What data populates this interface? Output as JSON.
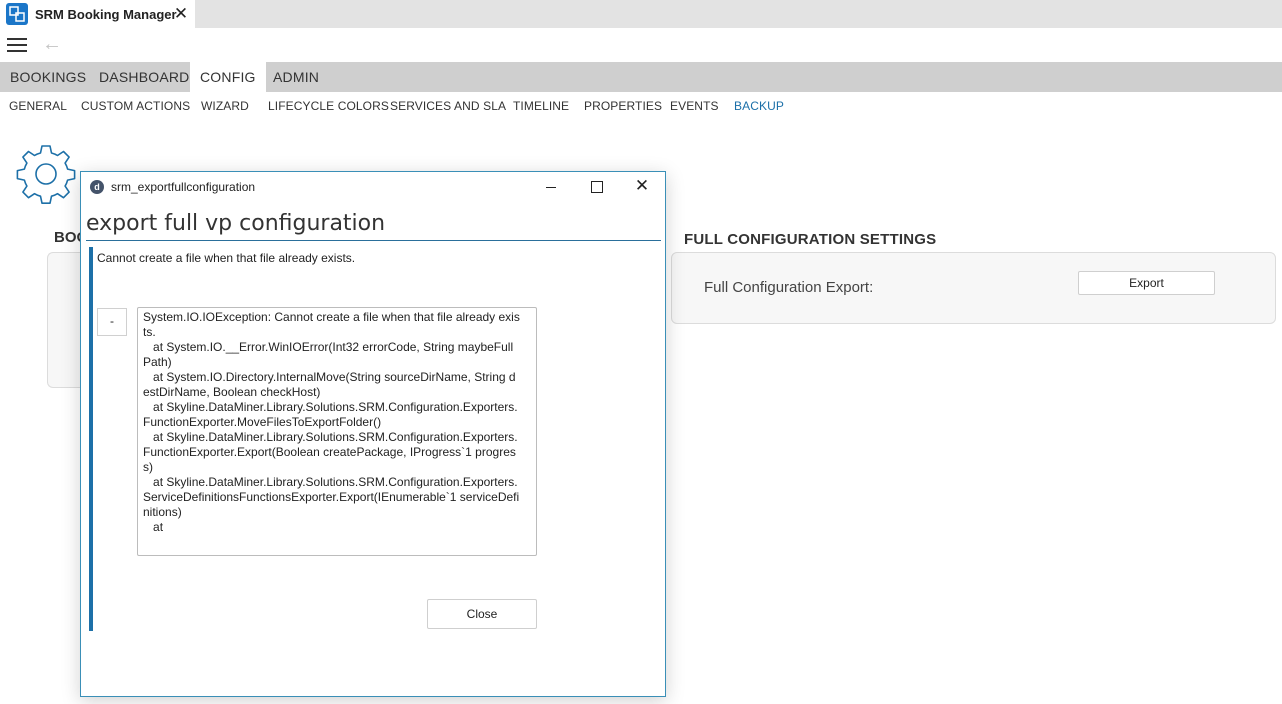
{
  "window": {
    "tab_title": "SRM Booking Manager",
    "tab_close": "✕"
  },
  "toolbar": {
    "back_glyph": "←"
  },
  "main_nav": [
    {
      "label": "BOOKINGS",
      "active": false
    },
    {
      "label": "DASHBOARD",
      "active": false
    },
    {
      "label": "CONFIG",
      "active": true
    },
    {
      "label": "ADMIN",
      "active": false
    }
  ],
  "sub_nav": [
    {
      "label": "GENERAL",
      "active": false
    },
    {
      "label": "CUSTOM ACTIONS",
      "active": false
    },
    {
      "label": "WIZARD",
      "active": false
    },
    {
      "label": "LIFECYCLE COLORS",
      "active": false
    },
    {
      "label": "SERVICES AND SLA",
      "active": false
    },
    {
      "label": "TIMELINE",
      "active": false
    },
    {
      "label": "PROPERTIES",
      "active": false
    },
    {
      "label": "EVENTS",
      "active": false
    },
    {
      "label": "BACKUP",
      "active": true
    }
  ],
  "page": {
    "left_heading_partial": "BOO",
    "full_config": {
      "heading": "FULL CONFIGURATION SETTINGS",
      "label": "Full Configuration Export:",
      "button": "Export"
    }
  },
  "dialog": {
    "icon_letter": "d",
    "window_title": "srm_exportfullconfiguration",
    "close_glyph": "✕",
    "heading": "export full vp configuration",
    "message": "Cannot create a file when that file already exists.",
    "collapse_label": "-",
    "details_lines": [
      "System.IO.IOException: Cannot create a file when that file already exists.",
      "",
      "   at System.IO.__Error.WinIOError(Int32 errorCode, String maybeFullPath)",
      "   at System.IO.Directory.InternalMove(String sourceDirName, String destDirName, Boolean checkHost)",
      "   at Skyline.DataMiner.Library.Solutions.SRM.Configuration.Exporters.FunctionExporter.MoveFilesToExportFolder()",
      "   at Skyline.DataMiner.Library.Solutions.SRM.Configuration.Exporters.FunctionExporter.Export(Boolean createPackage, IProgress`1 progress)",
      "   at Skyline.DataMiner.Library.Solutions.SRM.Configuration.Exporters.ServiceDefinitionsFunctionsExporter.Export(IEnumerable`1 serviceDefinitions)",
      "   at"
    ],
    "close_button": "Close"
  },
  "colors": {
    "accent": "#1d70a8",
    "nav_bg": "#cfcfcf",
    "active_sub": "#1b6fa8"
  }
}
